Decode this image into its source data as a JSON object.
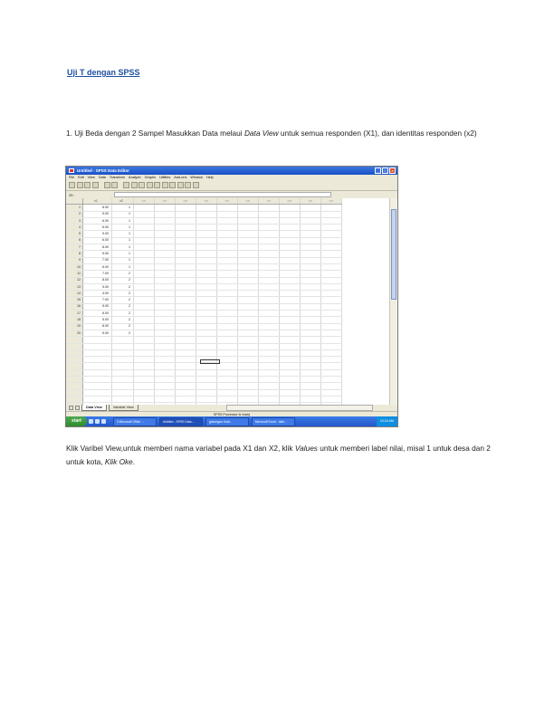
{
  "heading": "Uji T dengan SPSS",
  "para1": {
    "pre": "1. Uji Beda dengan 2 Sampel Masukkan Data melaui ",
    "em": "Data View",
    "post": " untuk semua responden (X1), dan identitas responden (x2)"
  },
  "para2": {
    "a": "Klik Varibel View,untuk memberi nama variabel pada X1 dan X2, klik ",
    "em1": "Values",
    "b": " untuk memberi label nilai, misal 1 untuk desa dan 2 untuk kota, ",
    "em2": "Klik Oke",
    "c": "."
  },
  "spss": {
    "title": "Untitled - SPSS Data Editor",
    "menu": [
      "File",
      "Edit",
      "View",
      "Data",
      "Transform",
      "Analyze",
      "Graphs",
      "Utilities",
      "Add-ons",
      "Window",
      "Help"
    ],
    "cell_ref": "25 :",
    "columns": [
      "x1",
      "x2",
      "var",
      "var",
      "var",
      "var",
      "var",
      "var",
      "var",
      "var",
      "var",
      "var"
    ],
    "rows": [
      [
        "8.00",
        "1"
      ],
      [
        "9.00",
        "1"
      ],
      [
        "6.00",
        "1"
      ],
      [
        "6.00",
        "1"
      ],
      [
        "9.00",
        "1"
      ],
      [
        "6.00",
        "1"
      ],
      [
        "8.00",
        "1"
      ],
      [
        "5.00",
        "1"
      ],
      [
        "7.00",
        "1"
      ],
      [
        "6.00",
        "1"
      ],
      [
        "7.00",
        "2"
      ],
      [
        "8.00",
        "2"
      ],
      [
        "5.00",
        "2"
      ],
      [
        "4.00",
        "2"
      ],
      [
        "7.00",
        "2"
      ],
      [
        "5.00",
        "2"
      ],
      [
        "6.00",
        "2"
      ],
      [
        "5.00",
        "2"
      ],
      [
        "8.00",
        "2"
      ],
      [
        "5.00",
        "2"
      ]
    ],
    "total_rows": 32,
    "tab_data_view": "Data View",
    "tab_variable_view": "Variable View",
    "status": "SPSS Processor is ready",
    "start": "start",
    "tasks": [
      "3 Microsoft Office ...",
      "Untitled - SPSS Data ...",
      "gabungan Kota...",
      "Microsoft Excel - latih..."
    ],
    "clock": "10:16 AM"
  }
}
